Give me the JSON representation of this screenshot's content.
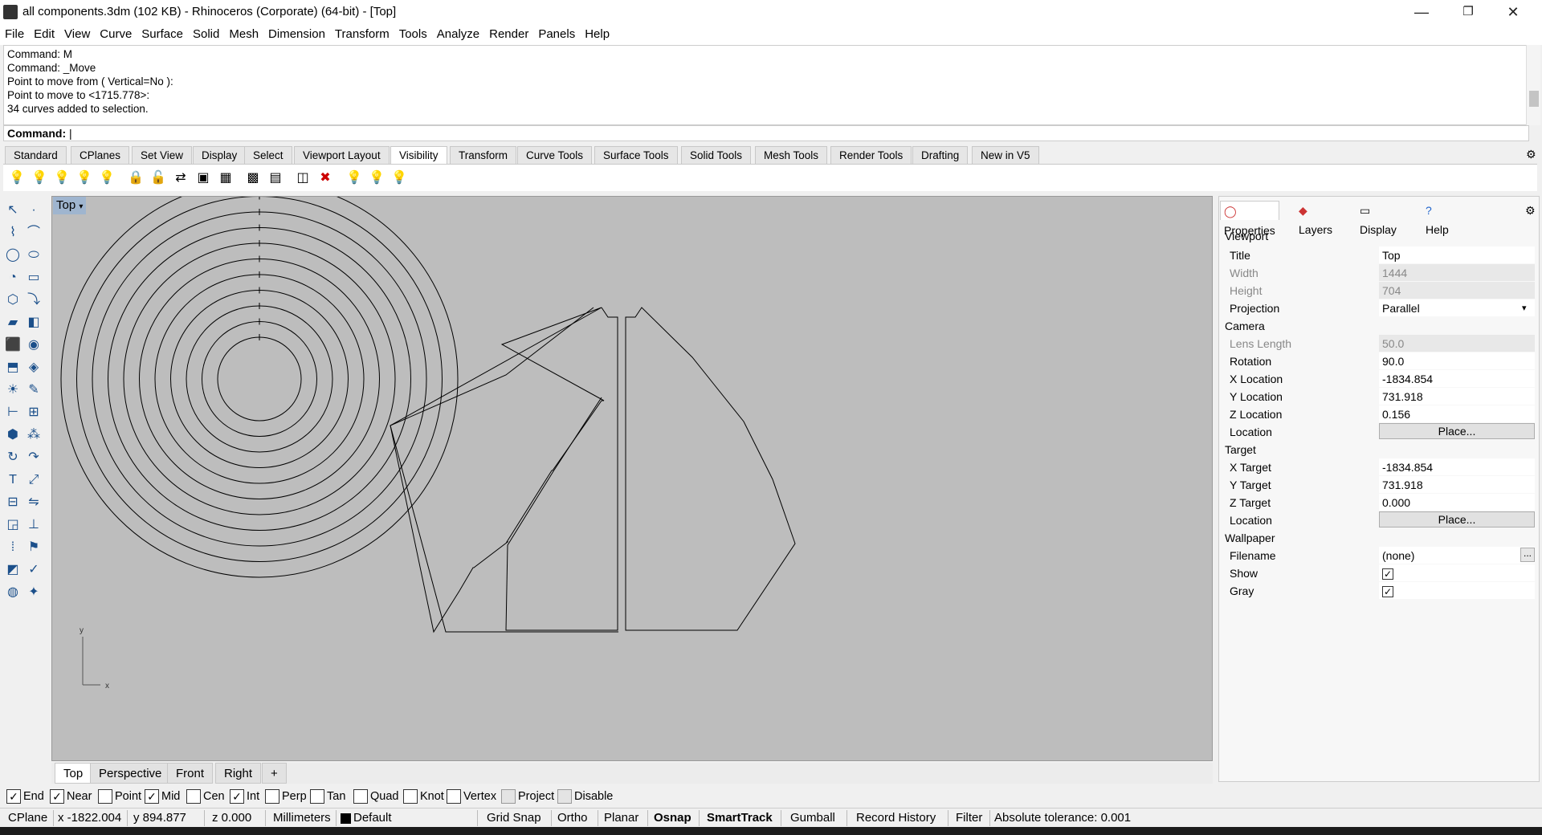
{
  "window": {
    "title": "all components.3dm (102 KB) - Rhinoceros (Corporate) (64-bit) - [Top]"
  },
  "menu": [
    "File",
    "Edit",
    "View",
    "Curve",
    "Surface",
    "Solid",
    "Mesh",
    "Dimension",
    "Transform",
    "Tools",
    "Analyze",
    "Render",
    "Panels",
    "Help"
  ],
  "command_history": [
    "Command: M",
    "Command: _Move",
    "Point to move from ( Vertical=No ):",
    "Point to move to <1715.778>:",
    "34 curves added to selection."
  ],
  "command_prompt": "Command:",
  "toolbar_tabs": [
    "Standard",
    "CPlanes",
    "Set View",
    "Display",
    "Select",
    "Viewport Layout",
    "Visibility",
    "Transform",
    "Curve Tools",
    "Surface Tools",
    "Solid Tools",
    "Mesh Tools",
    "Render Tools",
    "Drafting",
    "New in V5"
  ],
  "active_toolbar_tab": "Visibility",
  "viewport": {
    "title": "Top",
    "axis_y": "y",
    "axis_x": "x"
  },
  "viewport_tabs": [
    "Top",
    "Perspective",
    "Front",
    "Right"
  ],
  "panel_tabs": [
    "Properties",
    "Layers",
    "Display",
    "Help"
  ],
  "properties": {
    "viewport_section": "Viewport",
    "title_label": "Title",
    "title_value": "Top",
    "width_label": "Width",
    "width_value": "1444",
    "height_label": "Height",
    "height_value": "704",
    "projection_label": "Projection",
    "projection_value": "Parallel",
    "camera_section": "Camera",
    "lens_label": "Lens Length",
    "lens_value": "50.0",
    "rotation_label": "Rotation",
    "rotation_value": "90.0",
    "xloc_label": "X Location",
    "xloc_value": "-1834.854",
    "yloc_label": "Y Location",
    "yloc_value": "731.918",
    "zloc_label": "Z Location",
    "zloc_value": "0.156",
    "location_label": "Location",
    "place_label": "Place...",
    "target_section": "Target",
    "xt_label": "X Target",
    "xt_value": "-1834.854",
    "yt_label": "Y Target",
    "yt_value": "731.918",
    "zt_label": "Z Target",
    "zt_value": "0.000",
    "tloc_label": "Location",
    "tplace_label": "Place...",
    "wallpaper_section": "Wallpaper",
    "filename_label": "Filename",
    "filename_value": "(none)",
    "show_label": "Show",
    "gray_label": "Gray"
  },
  "osnap": {
    "end": "End",
    "near": "Near",
    "point": "Point",
    "mid": "Mid",
    "cen": "Cen",
    "int": "Int",
    "perp": "Perp",
    "tan": "Tan",
    "quad": "Quad",
    "knot": "Knot",
    "vertex": "Vertex",
    "project": "Project",
    "disable": "Disable"
  },
  "status": {
    "cplane": "CPlane",
    "x": "x -1822.004",
    "y": "y 894.877",
    "z": "z 0.000",
    "units": "Millimeters",
    "layer": "Default",
    "grid_snap": "Grid Snap",
    "ortho": "Ortho",
    "planar": "Planar",
    "osnap": "Osnap",
    "smarttrack": "SmartTrack",
    "gumball": "Gumball",
    "record_history": "Record History",
    "filter": "Filter",
    "tolerance": "Absolute tolerance: 0.001"
  }
}
